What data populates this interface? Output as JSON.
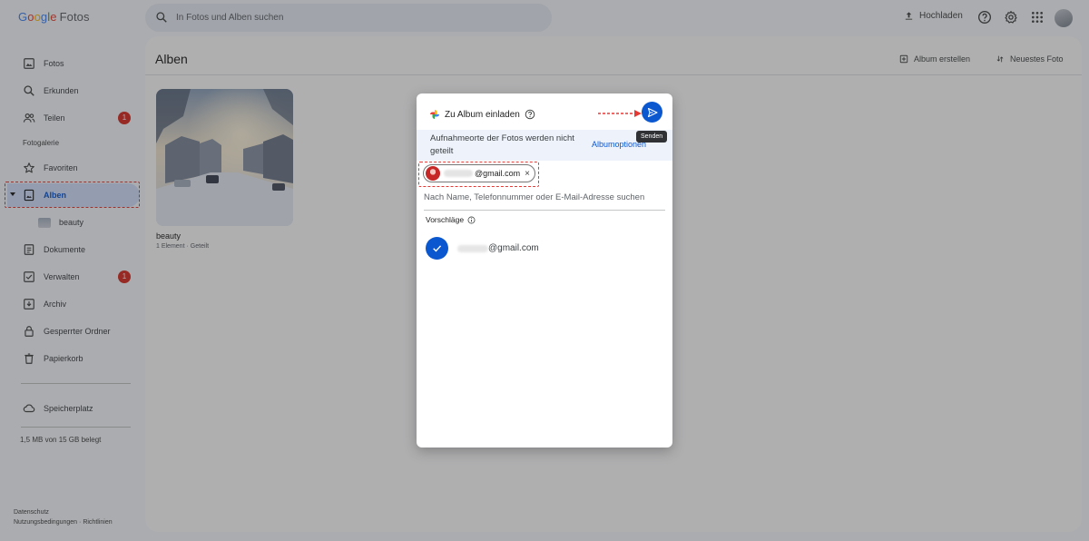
{
  "app": {
    "logo_letters": [
      "G",
      "o",
      "o",
      "g",
      "l",
      "e"
    ],
    "logo_product": "Fotos"
  },
  "search": {
    "placeholder": "In Fotos und Alben suchen"
  },
  "topbar": {
    "upload_label": "Hochladen",
    "icons": [
      "help-icon",
      "gear-icon",
      "apps-grid-icon",
      "account-avatar"
    ]
  },
  "sidebar": {
    "items": [
      {
        "label": "Fotos",
        "icon": "photo-icon"
      },
      {
        "label": "Erkunden",
        "icon": "search-icon"
      },
      {
        "label": "Teilen",
        "icon": "people-icon",
        "badge": "1"
      },
      {
        "label": "Favoriten",
        "icon": "star-icon"
      },
      {
        "label": "Alben",
        "icon": "album-icon"
      },
      {
        "label": "beauty",
        "icon": "album-thumbnail"
      },
      {
        "label": "Dokumente",
        "icon": "document-icon"
      },
      {
        "label": "Verwalten",
        "icon": "checklist-icon",
        "badge": "1"
      },
      {
        "label": "Archiv",
        "icon": "archive-icon"
      },
      {
        "label": "Gesperrter Ordner",
        "icon": "lock-icon"
      },
      {
        "label": "Papierkorb",
        "icon": "trash-icon"
      },
      {
        "label": "Speicherplatz",
        "icon": "cloud-icon"
      }
    ],
    "section_label": "Fotogalerie",
    "storage_text": "1,5 MB von 15 GB belegt",
    "footer": {
      "privacy": "Datenschutz",
      "terms": "Nutzungsbedingungen",
      "separator": "·",
      "guidelines": "Richtlinien"
    }
  },
  "main": {
    "title": "Alben",
    "create_album": "Album erstellen",
    "sort": "Neuestes Foto",
    "album": {
      "title": "beauty",
      "count": "1 Element",
      "separator": "·",
      "status": "Geteilt"
    }
  },
  "dialog": {
    "title": "Zu Album einladen",
    "send_tooltip": "Senden",
    "info_text": "Aufnahmeorte der Fotos werden nicht geteilt",
    "album_options": "Albumoptionen",
    "chip_email_suffix": "@gmail.com",
    "chip_remove": "×",
    "input_placeholder": "Nach Name, Telefonnummer oder E-Mail-Adresse suchen",
    "suggestions_label": "Vorschläge",
    "suggestion_email_suffix": "@gmail.com"
  },
  "colors": {
    "accent": "#0b57d0",
    "badge": "#d93025",
    "annotation": "#e53935",
    "active_nav_bg": "#d3e3fd"
  }
}
